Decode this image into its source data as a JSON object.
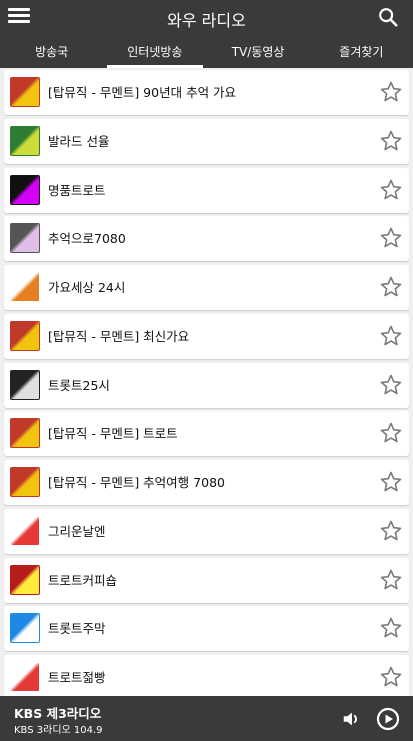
{
  "app": {
    "title": "와우 라디오"
  },
  "tabs": [
    {
      "label": "방송국"
    },
    {
      "label": "인터넷방송"
    },
    {
      "label": "TV/동영상"
    },
    {
      "label": "즐겨찾기"
    }
  ],
  "active_tab": "인터넷방송",
  "stations": [
    {
      "label": "[탑뮤직 - 무멘트] 90년대 추억 가요",
      "thumb_colors": [
        "#c0392b",
        "#f1c40f"
      ]
    },
    {
      "label": "발라드 선율",
      "thumb_colors": [
        "#2e7d32",
        "#cddc39"
      ]
    },
    {
      "label": "명품트로트",
      "thumb_colors": [
        "#111111",
        "#d500f9"
      ]
    },
    {
      "label": "추억으로7080",
      "thumb_colors": [
        "#555555",
        "#e1bee7"
      ]
    },
    {
      "label": "가요세상 24시",
      "thumb_colors": [
        "#ffffff",
        "#e67e22"
      ]
    },
    {
      "label": "[탑뮤직 - 무멘트] 최신가요",
      "thumb_colors": [
        "#c0392b",
        "#f1c40f"
      ]
    },
    {
      "label": "트롯트25시",
      "thumb_colors": [
        "#222222",
        "#e0e0e0"
      ]
    },
    {
      "label": "[탑뮤직 - 무멘트] 트로트",
      "thumb_colors": [
        "#c0392b",
        "#f1c40f"
      ]
    },
    {
      "label": "[탑뮤직 - 무멘트] 추억여행 7080",
      "thumb_colors": [
        "#c0392b",
        "#f1c40f"
      ]
    },
    {
      "label": "그리운날엔",
      "thumb_colors": [
        "#ffffff",
        "#e53935"
      ]
    },
    {
      "label": "트로트커피숍",
      "thumb_colors": [
        "#b71c1c",
        "#ffeb3b"
      ]
    },
    {
      "label": "트롯트주막",
      "thumb_colors": [
        "#1e88e5",
        "#ffffff"
      ]
    },
    {
      "label": "트로트젊빵",
      "thumb_colors": [
        "#ffffff",
        "#e53935"
      ]
    }
  ],
  "player": {
    "station_name": "KBS 제3라디오",
    "station_sub": "KBS 3라디오 104.9"
  },
  "colors": {
    "bar": "#3a3a3a",
    "background": "#f0f0f0",
    "star_outline": "#7a7a7a"
  },
  "icons": {
    "menu": "menu-icon",
    "search": "search-icon",
    "star": "star-outline-icon",
    "volume": "volume-icon",
    "play": "play-circle-icon"
  }
}
